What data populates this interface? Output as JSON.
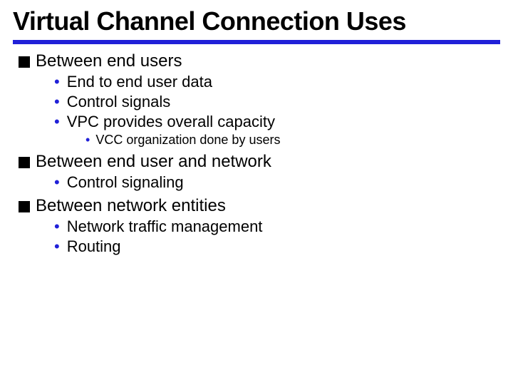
{
  "title": "Virtual Channel Connection Uses",
  "sections": [
    {
      "heading": "Between end users",
      "items": [
        {
          "text": "End to end user data"
        },
        {
          "text": "Control signals"
        },
        {
          "text": "VPC provides overall capacity",
          "subitems": [
            {
              "text": "VCC organization done by users"
            }
          ]
        }
      ]
    },
    {
      "heading": "Between end user and network",
      "items": [
        {
          "text": "Control signaling"
        }
      ]
    },
    {
      "heading": "Between network entities",
      "items": [
        {
          "text": "Network traffic management"
        },
        {
          "text": "Routing"
        }
      ]
    }
  ]
}
